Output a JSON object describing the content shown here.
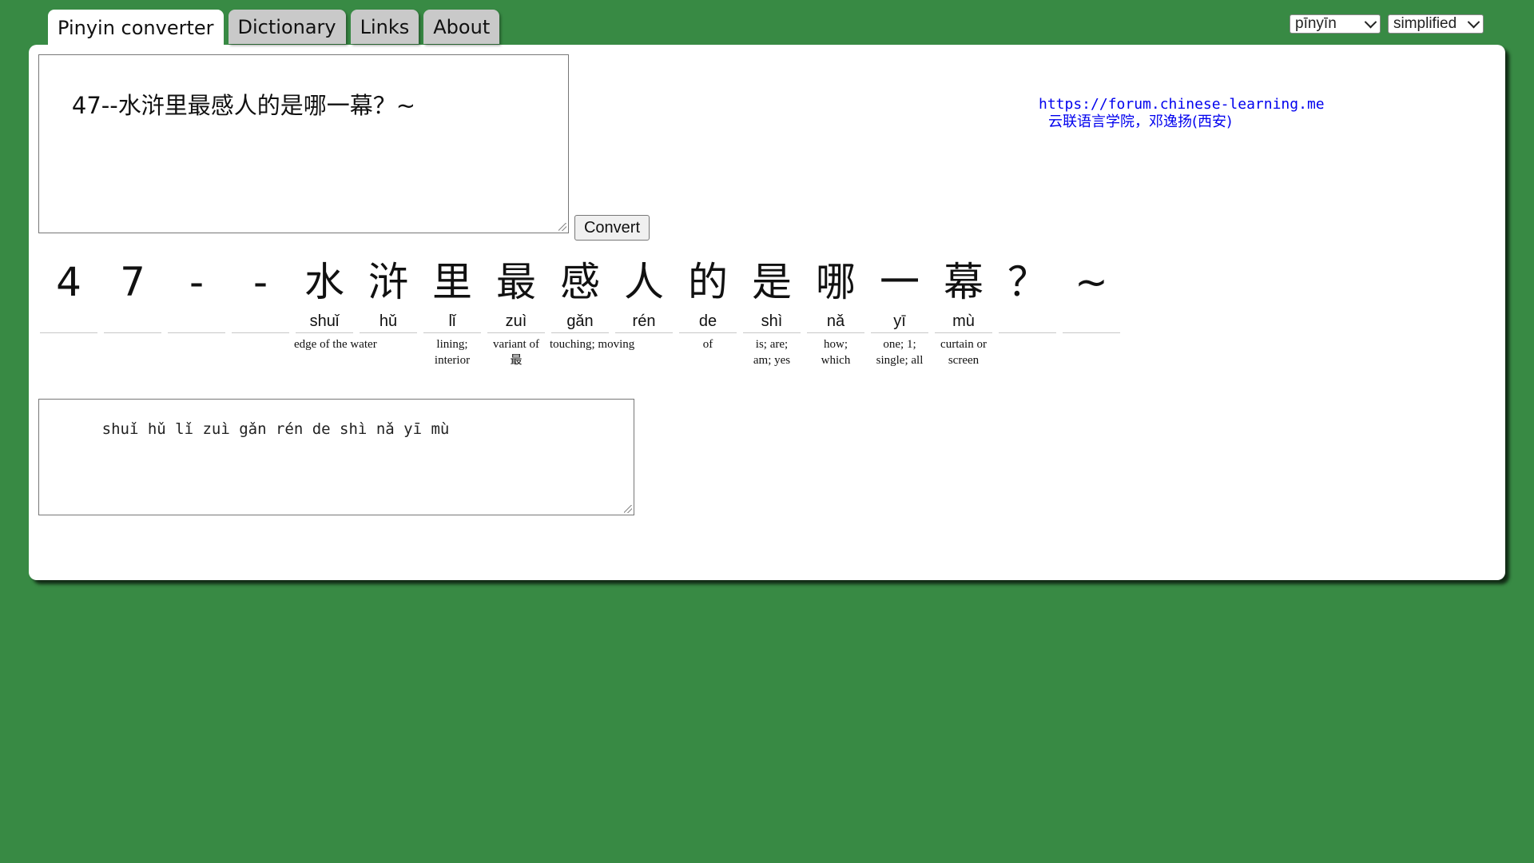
{
  "tabs": [
    {
      "label": "Pinyin converter",
      "active": true
    },
    {
      "label": "Dictionary",
      "active": false
    },
    {
      "label": "Links",
      "active": false
    },
    {
      "label": "About",
      "active": false
    }
  ],
  "selects": {
    "script": "pīnyīn",
    "form": "simplified"
  },
  "input": {
    "value": "47--水浒里最感人的是哪一幕？~"
  },
  "convert_label": "Convert",
  "credits": {
    "url": "https://forum.chinese-learning.me",
    "author": "云联语言学院，邓逸扬(西安)"
  },
  "characters": [
    {
      "hanzi": "4",
      "pinyin": "",
      "gloss": ""
    },
    {
      "hanzi": "7",
      "pinyin": "",
      "gloss": ""
    },
    {
      "hanzi": "-",
      "pinyin": "",
      "gloss": ""
    },
    {
      "hanzi": "-",
      "pinyin": "",
      "gloss": ""
    },
    {
      "hanzi": "水",
      "pinyin": "shuǐ",
      "gloss": "edge of the water"
    },
    {
      "hanzi": "浒",
      "pinyin": "hǔ",
      "gloss": ""
    },
    {
      "hanzi": "里",
      "pinyin": "lǐ",
      "gloss": "lining;\ninterior"
    },
    {
      "hanzi": "最",
      "pinyin": "zuì",
      "gloss": "variant of\n最"
    },
    {
      "hanzi": "感",
      "pinyin": "gǎn",
      "gloss": "touching; moving"
    },
    {
      "hanzi": "人",
      "pinyin": "rén",
      "gloss": ""
    },
    {
      "hanzi": "的",
      "pinyin": "de",
      "gloss": "of"
    },
    {
      "hanzi": "是",
      "pinyin": "shì",
      "gloss": "is; are;\nam; yes"
    },
    {
      "hanzi": "哪",
      "pinyin": "nǎ",
      "gloss": "how;\nwhich"
    },
    {
      "hanzi": "一",
      "pinyin": "yī",
      "gloss": "one; 1;\nsingle; all"
    },
    {
      "hanzi": "幕",
      "pinyin": "mù",
      "gloss": "curtain or\nscreen"
    },
    {
      "hanzi": "？",
      "pinyin": "",
      "gloss": ""
    },
    {
      "hanzi": "~",
      "pinyin": "",
      "gloss": ""
    }
  ],
  "output": {
    "value": "  shuǐ hǔ lǐ zuì gǎn rén de shì nǎ yī mù"
  }
}
